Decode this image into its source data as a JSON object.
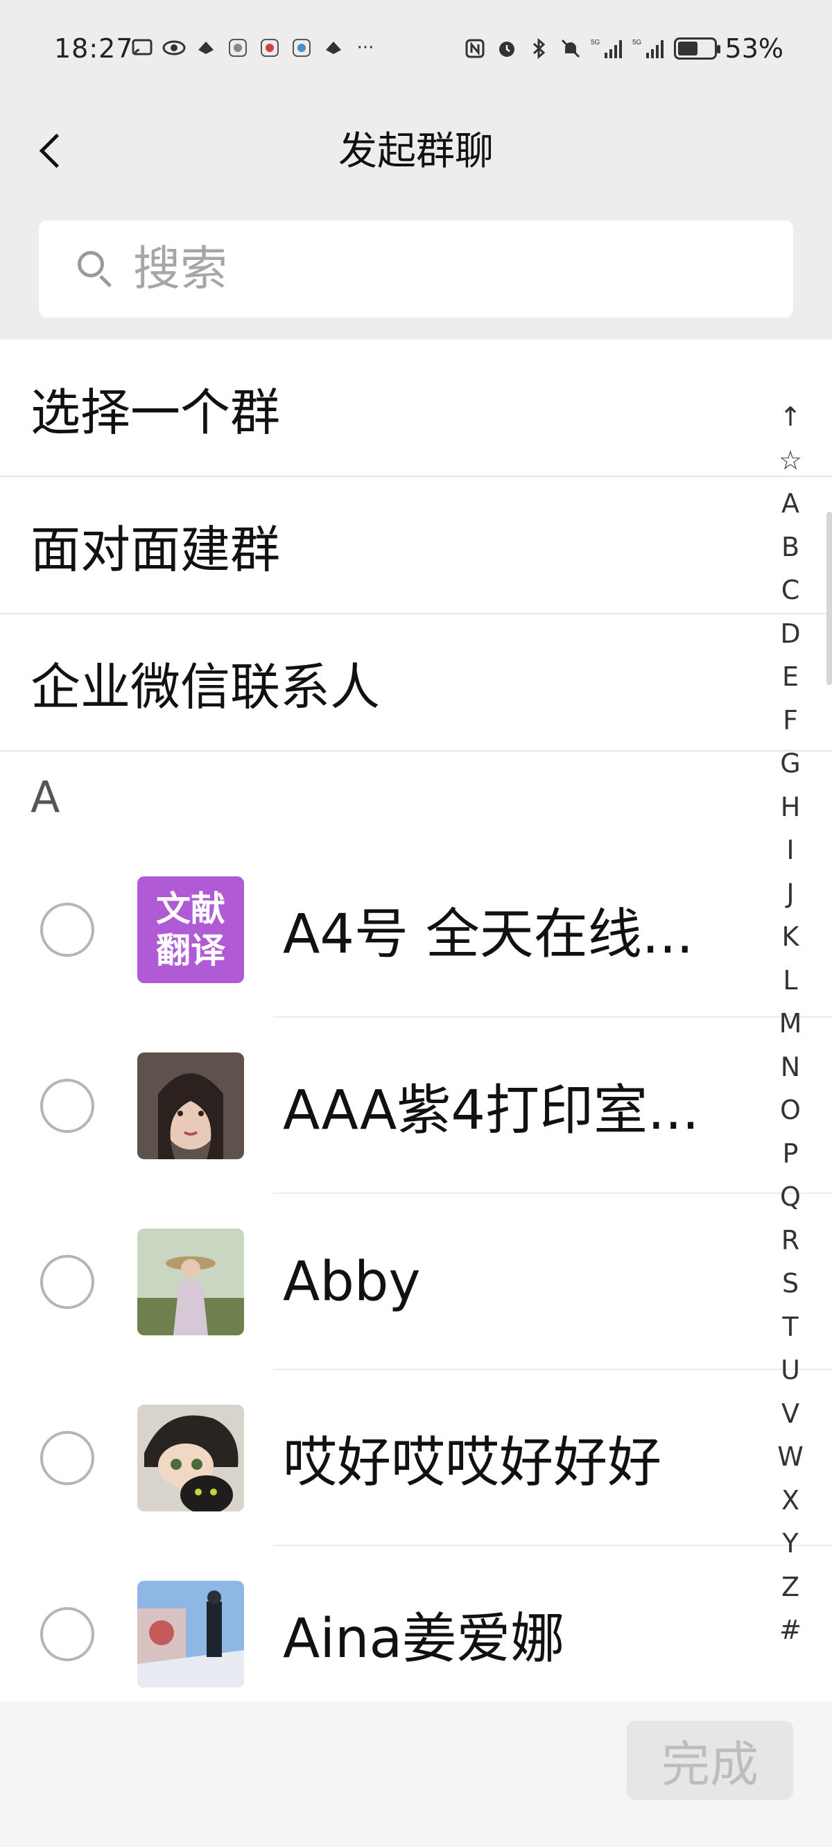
{
  "status_bar": {
    "time": "18:27",
    "battery": "53%",
    "icons_left": [
      "cast-icon",
      "eye-icon",
      "app-icon",
      "app-icon",
      "app-icon",
      "app-icon",
      "app-icon",
      "more-icon"
    ],
    "icons_right": [
      "nfc-icon",
      "alarm-icon",
      "bluetooth-icon",
      "mute-icon",
      "signal-5g-icon",
      "signal-5g-icon",
      "battery-icon"
    ],
    "more": "···",
    "signal_1": "5G",
    "signal_2": "5G"
  },
  "nav": {
    "title": "发起群聊"
  },
  "search": {
    "placeholder": "搜索"
  },
  "options": [
    {
      "label": "选择一个群"
    },
    {
      "label": "面对面建群"
    },
    {
      "label": "企业微信联系人"
    }
  ],
  "section": {
    "letter": "A"
  },
  "contacts": [
    {
      "name": "A4号 全天在线...",
      "avatar_text_line1": "文献",
      "avatar_text_line2": "翻译",
      "avatar_color": "#b05ad6"
    },
    {
      "name": "AAA紫4打印室...",
      "avatar_color": "#6a5a55"
    },
    {
      "name": "Abby",
      "avatar_color": "#8aa27a"
    },
    {
      "name": "哎好哎哎好好好",
      "avatar_color": "#3a3633"
    },
    {
      "name": "Aina姜爱娜",
      "avatar_color": "#5b7fb2"
    }
  ],
  "index_bar": [
    "↑",
    "☆",
    "A",
    "B",
    "C",
    "D",
    "E",
    "F",
    "G",
    "H",
    "I",
    "J",
    "K",
    "L",
    "M",
    "N",
    "O",
    "P",
    "Q",
    "R",
    "S",
    "T",
    "U",
    "V",
    "W",
    "X",
    "Y",
    "Z",
    "#"
  ],
  "footer": {
    "done_label": "完成"
  }
}
